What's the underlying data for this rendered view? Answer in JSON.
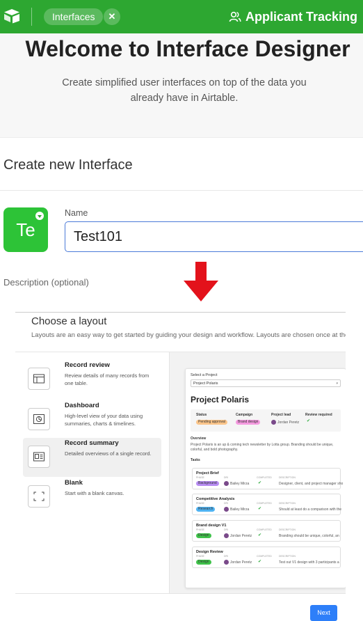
{
  "topbar": {
    "tab_label": "Interfaces",
    "close_glyph": "✕",
    "base_name": "Applicant Tracking",
    "accent_color": "#2da731"
  },
  "hero": {
    "title": "Welcome to Interface Designer",
    "subtitle": "Create simplified user interfaces on top of the data you already have in Airtable."
  },
  "create": {
    "heading": "Create new Interface",
    "avatar_text": "Te",
    "name_label": "Name",
    "name_value": "Test101",
    "description_label": "Description (optional)"
  },
  "layout_picker": {
    "title": "Choose a layout",
    "subtitle": "Layouts are an easy way to get started by guiding your design and workflow. Layouts are chosen once at the sta",
    "options": [
      {
        "title": "Record review",
        "desc": "Review details of many records from one table.",
        "icon": "record-review-icon",
        "selected": false
      },
      {
        "title": "Dashboard",
        "desc": "High-level view of your data using summaries, charts & timelines.",
        "icon": "dashboard-icon",
        "selected": false
      },
      {
        "title": "Record summary",
        "desc": "Detailed overviews of a single record.",
        "icon": "record-summary-icon",
        "selected": true
      },
      {
        "title": "Blank",
        "desc": "Start with a blank canvas.",
        "icon": "blank-icon",
        "selected": false
      }
    ],
    "next_label": "Next"
  },
  "preview": {
    "select_label": "Select a Project",
    "select_value": "Project Polaris",
    "title": "Project Polaris",
    "fields": {
      "status_label": "Status",
      "status_value": "Pending approval",
      "campaign_label": "Campaign",
      "campaign_value": "Brand design",
      "lead_label": "Project lead",
      "lead_value": "Jordan Peretz",
      "review_label": "Review required",
      "review_value": "✔"
    },
    "overview_label": "Overview",
    "overview_text": "Project Polaris is an up & coming tech newsletter by Lotta group. Branding should be unique, colorful, and bold photography.",
    "tasks_label": "Tasks",
    "col_phase": "PHASE",
    "col_dri": "DRI",
    "col_completed": "COMPLETED",
    "col_description": "DESCRIPTION",
    "tasks": [
      {
        "title": "Project Brief",
        "phase": "Background",
        "phase_color": "#b78cf2",
        "dri": "Bailey Mirza",
        "completed": "✔",
        "description": "Designer, client, and project manager sho"
      },
      {
        "title": "Competitive Analysis",
        "phase": "Research",
        "phase_color": "#4fb3f2",
        "dri": "Bailey Mirza",
        "completed": "✔",
        "description": "Should at least do a comparison with the"
      },
      {
        "title": "Brand design V1",
        "phase": "Design",
        "phase_color": "#3fc24a",
        "dri": "Jordan Peretz",
        "completed": "✔",
        "description": "Branding should be unique, colorful, an"
      },
      {
        "title": "Design Review",
        "phase": "Design",
        "phase_color": "#3fc24a",
        "dri": "Jordan Peretz",
        "completed": "✔",
        "description": "Test out V1 design with 3 participants a"
      }
    ]
  }
}
